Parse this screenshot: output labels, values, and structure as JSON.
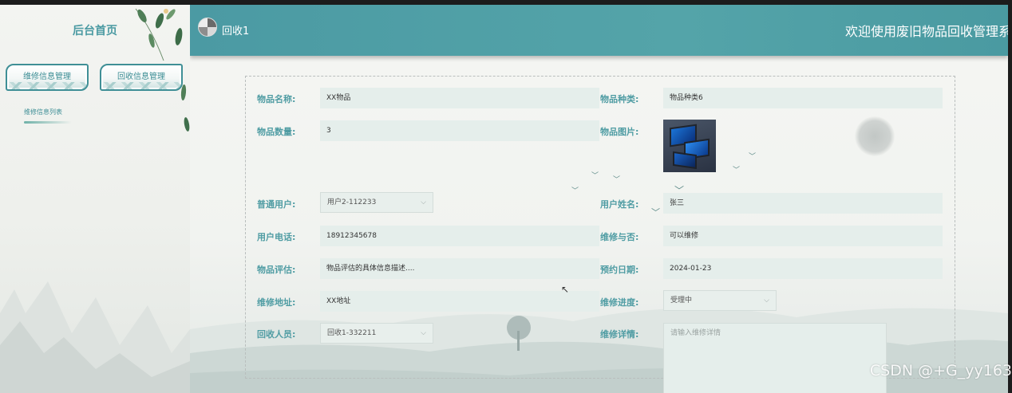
{
  "sidebar": {
    "title": "后台首页",
    "menu": [
      {
        "label": "维修信息管理"
      },
      {
        "label": "回收信息管理"
      }
    ],
    "sub_item": "维修信息列表"
  },
  "header": {
    "username": "回收1",
    "system_title": "欢迎使用废旧物品回收管理系统"
  },
  "form": {
    "item_name": {
      "label": "物品名称:",
      "value": "XX物品"
    },
    "item_type": {
      "label": "物品种类:",
      "value": "物品种类6"
    },
    "item_qty": {
      "label": "物品数量:",
      "value": "3"
    },
    "item_image": {
      "label": "物品图片:"
    },
    "user": {
      "label": "普通用户:",
      "value": "用户2-112233"
    },
    "user_name": {
      "label": "用户姓名:",
      "value": "张三"
    },
    "user_phone": {
      "label": "用户电话:",
      "value": "18912345678"
    },
    "repairable": {
      "label": "维修与否:",
      "value": "可以维修"
    },
    "evaluation": {
      "label": "物品评估:",
      "value": "物品评估的具体信息描述...."
    },
    "appointment_date": {
      "label": "预约日期:",
      "value": "2024-01-23"
    },
    "repair_address": {
      "label": "维修地址:",
      "value": "XX地址"
    },
    "repair_progress": {
      "label": "维修进度:",
      "value": "受理中"
    },
    "recycler": {
      "label": "回收人员:",
      "value": "回收1-332211"
    },
    "repair_details": {
      "label": "维修详情:",
      "placeholder": "请输入维修详情"
    }
  },
  "watermark": "CSDN @+G_yy163",
  "colors": {
    "accent": "#4f9ca3",
    "header": "#4b9aa3",
    "field_bg": "#e5eeeb"
  }
}
